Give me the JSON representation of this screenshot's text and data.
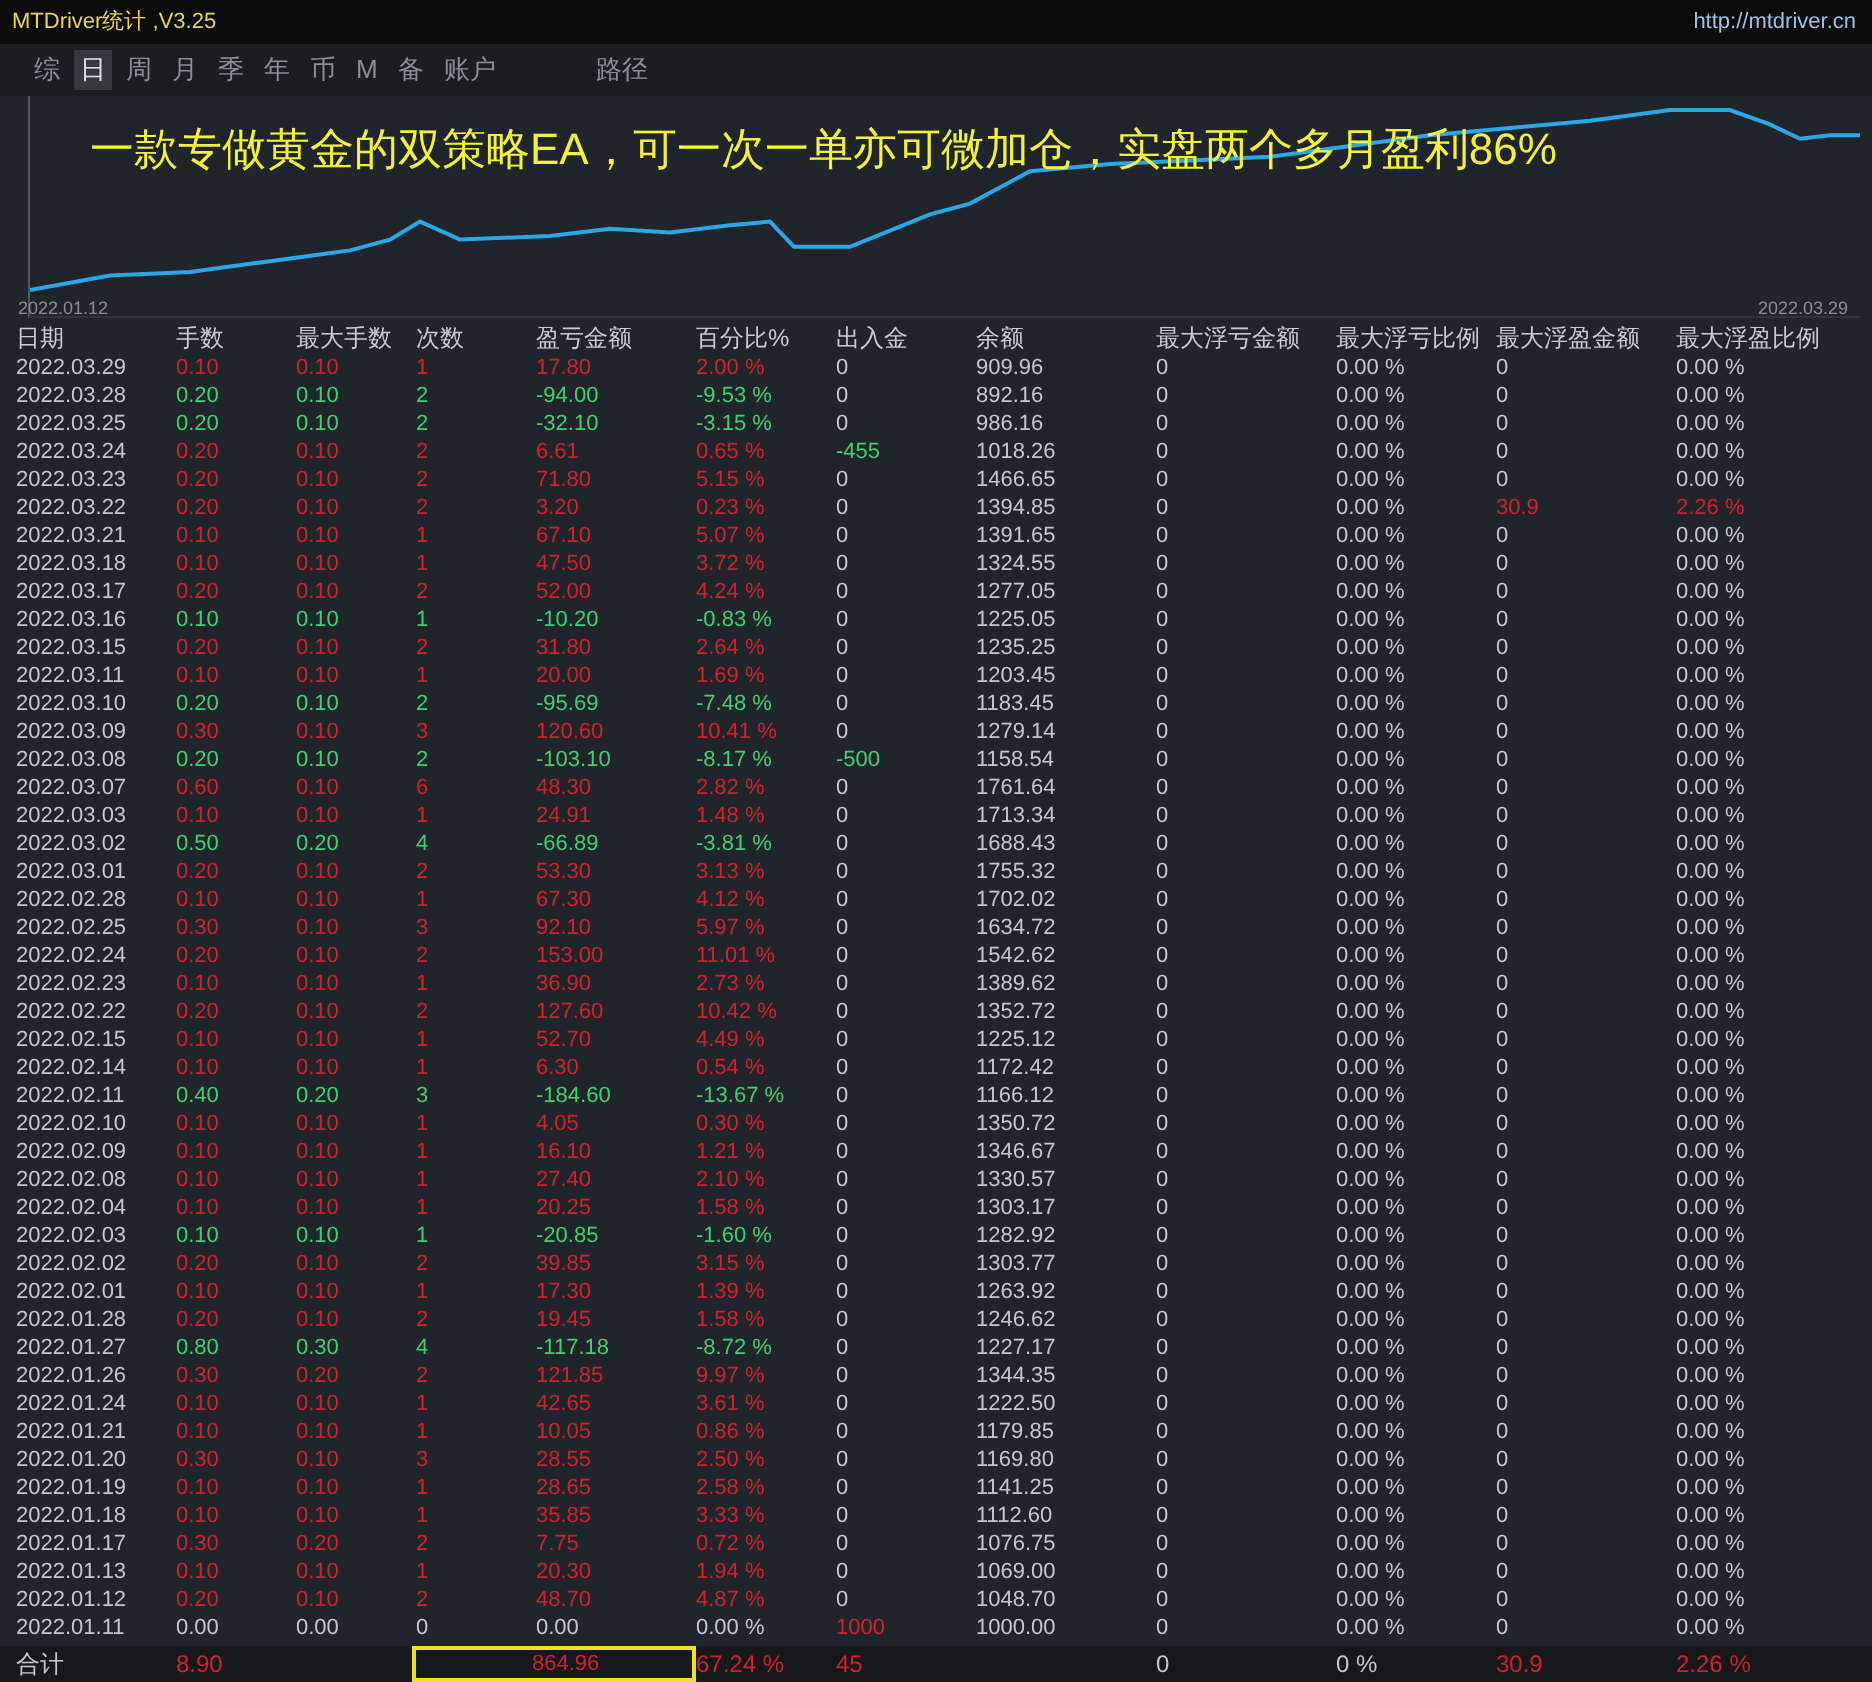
{
  "window": {
    "title": "MTDriver统计 ,V3.25",
    "link": "http://mtdriver.cn"
  },
  "tabs": [
    {
      "label": "综",
      "selected": false
    },
    {
      "label": "日",
      "selected": true
    },
    {
      "label": "周",
      "selected": false
    },
    {
      "label": "月",
      "selected": false
    },
    {
      "label": "季",
      "selected": false
    },
    {
      "label": "年",
      "selected": false
    },
    {
      "label": "币",
      "selected": false
    },
    {
      "label": "M",
      "selected": false
    },
    {
      "label": "备",
      "selected": false
    },
    {
      "label": "账户",
      "selected": false
    },
    {
      "label": "路径",
      "selected": false
    }
  ],
  "chart": {
    "caption": "一款专做黄金的双策略EA，可一次一单亦可微加仓，实盘两个多月盈利86%",
    "start_label": "2022.01.12",
    "end_label": "2022.03.29"
  },
  "table": {
    "columns": [
      "日期",
      "手数",
      "最大手数",
      "次数",
      "盈亏金额",
      "百分比%",
      "出入金",
      "余额",
      "最大浮亏金额",
      "最大浮亏比例",
      "最大浮盈金额",
      "最大浮盈比例"
    ],
    "rows": [
      {
        "kind": "profit",
        "withdrawal": false,
        "deposit": false,
        "float_profit": false,
        "cells": [
          "2022.03.29",
          "0.10",
          "0.10",
          "1",
          "17.80",
          "2.00 %",
          "0",
          "909.96",
          "0",
          "0.00 %",
          "0",
          "0.00 %"
        ]
      },
      {
        "kind": "loss",
        "withdrawal": false,
        "deposit": false,
        "float_profit": false,
        "cells": [
          "2022.03.28",
          "0.20",
          "0.10",
          "2",
          "-94.00",
          "-9.53 %",
          "0",
          "892.16",
          "0",
          "0.00 %",
          "0",
          "0.00 %"
        ]
      },
      {
        "kind": "loss",
        "withdrawal": false,
        "deposit": false,
        "float_profit": false,
        "cells": [
          "2022.03.25",
          "0.20",
          "0.10",
          "2",
          "-32.10",
          "-3.15 %",
          "0",
          "986.16",
          "0",
          "0.00 %",
          "0",
          "0.00 %"
        ]
      },
      {
        "kind": "profit",
        "withdrawal": true,
        "deposit": false,
        "float_profit": false,
        "cells": [
          "2022.03.24",
          "0.20",
          "0.10",
          "2",
          "6.61",
          "0.65 %",
          "-455",
          "1018.26",
          "0",
          "0.00 %",
          "0",
          "0.00 %"
        ]
      },
      {
        "kind": "profit",
        "withdrawal": false,
        "deposit": false,
        "float_profit": false,
        "cells": [
          "2022.03.23",
          "0.20",
          "0.10",
          "2",
          "71.80",
          "5.15 %",
          "0",
          "1466.65",
          "0",
          "0.00 %",
          "0",
          "0.00 %"
        ]
      },
      {
        "kind": "profit",
        "withdrawal": false,
        "deposit": false,
        "float_profit": true,
        "cells": [
          "2022.03.22",
          "0.20",
          "0.10",
          "2",
          "3.20",
          "0.23 %",
          "0",
          "1394.85",
          "0",
          "0.00 %",
          "30.9",
          "2.26 %"
        ]
      },
      {
        "kind": "profit",
        "withdrawal": false,
        "deposit": false,
        "float_profit": false,
        "cells": [
          "2022.03.21",
          "0.10",
          "0.10",
          "1",
          "67.10",
          "5.07 %",
          "0",
          "1391.65",
          "0",
          "0.00 %",
          "0",
          "0.00 %"
        ]
      },
      {
        "kind": "profit",
        "withdrawal": false,
        "deposit": false,
        "float_profit": false,
        "cells": [
          "2022.03.18",
          "0.10",
          "0.10",
          "1",
          "47.50",
          "3.72 %",
          "0",
          "1324.55",
          "0",
          "0.00 %",
          "0",
          "0.00 %"
        ]
      },
      {
        "kind": "profit",
        "withdrawal": false,
        "deposit": false,
        "float_profit": false,
        "cells": [
          "2022.03.17",
          "0.20",
          "0.10",
          "2",
          "52.00",
          "4.24 %",
          "0",
          "1277.05",
          "0",
          "0.00 %",
          "0",
          "0.00 %"
        ]
      },
      {
        "kind": "loss",
        "withdrawal": false,
        "deposit": false,
        "float_profit": false,
        "cells": [
          "2022.03.16",
          "0.10",
          "0.10",
          "1",
          "-10.20",
          "-0.83 %",
          "0",
          "1225.05",
          "0",
          "0.00 %",
          "0",
          "0.00 %"
        ]
      },
      {
        "kind": "profit",
        "withdrawal": false,
        "deposit": false,
        "float_profit": false,
        "cells": [
          "2022.03.15",
          "0.20",
          "0.10",
          "2",
          "31.80",
          "2.64 %",
          "0",
          "1235.25",
          "0",
          "0.00 %",
          "0",
          "0.00 %"
        ]
      },
      {
        "kind": "profit",
        "withdrawal": false,
        "deposit": false,
        "float_profit": false,
        "cells": [
          "2022.03.11",
          "0.10",
          "0.10",
          "1",
          "20.00",
          "1.69 %",
          "0",
          "1203.45",
          "0",
          "0.00 %",
          "0",
          "0.00 %"
        ]
      },
      {
        "kind": "loss",
        "withdrawal": false,
        "deposit": false,
        "float_profit": false,
        "cells": [
          "2022.03.10",
          "0.20",
          "0.10",
          "2",
          "-95.69",
          "-7.48 %",
          "0",
          "1183.45",
          "0",
          "0.00 %",
          "0",
          "0.00 %"
        ]
      },
      {
        "kind": "profit",
        "withdrawal": false,
        "deposit": false,
        "float_profit": false,
        "cells": [
          "2022.03.09",
          "0.30",
          "0.10",
          "3",
          "120.60",
          "10.41 %",
          "0",
          "1279.14",
          "0",
          "0.00 %",
          "0",
          "0.00 %"
        ]
      },
      {
        "kind": "loss",
        "withdrawal": true,
        "deposit": false,
        "float_profit": false,
        "cells": [
          "2022.03.08",
          "0.20",
          "0.10",
          "2",
          "-103.10",
          "-8.17 %",
          "-500",
          "1158.54",
          "0",
          "0.00 %",
          "0",
          "0.00 %"
        ]
      },
      {
        "kind": "profit",
        "withdrawal": false,
        "deposit": false,
        "float_profit": false,
        "cells": [
          "2022.03.07",
          "0.60",
          "0.10",
          "6",
          "48.30",
          "2.82 %",
          "0",
          "1761.64",
          "0",
          "0.00 %",
          "0",
          "0.00 %"
        ]
      },
      {
        "kind": "profit",
        "withdrawal": false,
        "deposit": false,
        "float_profit": false,
        "cells": [
          "2022.03.03",
          "0.10",
          "0.10",
          "1",
          "24.91",
          "1.48 %",
          "0",
          "1713.34",
          "0",
          "0.00 %",
          "0",
          "0.00 %"
        ]
      },
      {
        "kind": "loss",
        "withdrawal": false,
        "deposit": false,
        "float_profit": false,
        "cells": [
          "2022.03.02",
          "0.50",
          "0.20",
          "4",
          "-66.89",
          "-3.81 %",
          "0",
          "1688.43",
          "0",
          "0.00 %",
          "0",
          "0.00 %"
        ]
      },
      {
        "kind": "profit",
        "withdrawal": false,
        "deposit": false,
        "float_profit": false,
        "cells": [
          "2022.03.01",
          "0.20",
          "0.10",
          "2",
          "53.30",
          "3.13 %",
          "0",
          "1755.32",
          "0",
          "0.00 %",
          "0",
          "0.00 %"
        ]
      },
      {
        "kind": "profit",
        "withdrawal": false,
        "deposit": false,
        "float_profit": false,
        "cells": [
          "2022.02.28",
          "0.10",
          "0.10",
          "1",
          "67.30",
          "4.12 %",
          "0",
          "1702.02",
          "0",
          "0.00 %",
          "0",
          "0.00 %"
        ]
      },
      {
        "kind": "profit",
        "withdrawal": false,
        "deposit": false,
        "float_profit": false,
        "cells": [
          "2022.02.25",
          "0.30",
          "0.10",
          "3",
          "92.10",
          "5.97 %",
          "0",
          "1634.72",
          "0",
          "0.00 %",
          "0",
          "0.00 %"
        ]
      },
      {
        "kind": "profit",
        "withdrawal": false,
        "deposit": false,
        "float_profit": false,
        "cells": [
          "2022.02.24",
          "0.20",
          "0.10",
          "2",
          "153.00",
          "11.01 %",
          "0",
          "1542.62",
          "0",
          "0.00 %",
          "0",
          "0.00 %"
        ]
      },
      {
        "kind": "profit",
        "withdrawal": false,
        "deposit": false,
        "float_profit": false,
        "cells": [
          "2022.02.23",
          "0.10",
          "0.10",
          "1",
          "36.90",
          "2.73 %",
          "0",
          "1389.62",
          "0",
          "0.00 %",
          "0",
          "0.00 %"
        ]
      },
      {
        "kind": "profit",
        "withdrawal": false,
        "deposit": false,
        "float_profit": false,
        "cells": [
          "2022.02.22",
          "0.20",
          "0.10",
          "2",
          "127.60",
          "10.42 %",
          "0",
          "1352.72",
          "0",
          "0.00 %",
          "0",
          "0.00 %"
        ]
      },
      {
        "kind": "profit",
        "withdrawal": false,
        "deposit": false,
        "float_profit": false,
        "cells": [
          "2022.02.15",
          "0.10",
          "0.10",
          "1",
          "52.70",
          "4.49 %",
          "0",
          "1225.12",
          "0",
          "0.00 %",
          "0",
          "0.00 %"
        ]
      },
      {
        "kind": "profit",
        "withdrawal": false,
        "deposit": false,
        "float_profit": false,
        "cells": [
          "2022.02.14",
          "0.10",
          "0.10",
          "1",
          "6.30",
          "0.54 %",
          "0",
          "1172.42",
          "0",
          "0.00 %",
          "0",
          "0.00 %"
        ]
      },
      {
        "kind": "loss",
        "withdrawal": false,
        "deposit": false,
        "float_profit": false,
        "cells": [
          "2022.02.11",
          "0.40",
          "0.20",
          "3",
          "-184.60",
          "-13.67 %",
          "0",
          "1166.12",
          "0",
          "0.00 %",
          "0",
          "0.00 %"
        ]
      },
      {
        "kind": "profit",
        "withdrawal": false,
        "deposit": false,
        "float_profit": false,
        "cells": [
          "2022.02.10",
          "0.10",
          "0.10",
          "1",
          "4.05",
          "0.30 %",
          "0",
          "1350.72",
          "0",
          "0.00 %",
          "0",
          "0.00 %"
        ]
      },
      {
        "kind": "profit",
        "withdrawal": false,
        "deposit": false,
        "float_profit": false,
        "cells": [
          "2022.02.09",
          "0.10",
          "0.10",
          "1",
          "16.10",
          "1.21 %",
          "0",
          "1346.67",
          "0",
          "0.00 %",
          "0",
          "0.00 %"
        ]
      },
      {
        "kind": "profit",
        "withdrawal": false,
        "deposit": false,
        "float_profit": false,
        "cells": [
          "2022.02.08",
          "0.10",
          "0.10",
          "1",
          "27.40",
          "2.10 %",
          "0",
          "1330.57",
          "0",
          "0.00 %",
          "0",
          "0.00 %"
        ]
      },
      {
        "kind": "profit",
        "withdrawal": false,
        "deposit": false,
        "float_profit": false,
        "cells": [
          "2022.02.04",
          "0.10",
          "0.10",
          "1",
          "20.25",
          "1.58 %",
          "0",
          "1303.17",
          "0",
          "0.00 %",
          "0",
          "0.00 %"
        ]
      },
      {
        "kind": "loss",
        "withdrawal": false,
        "deposit": false,
        "float_profit": false,
        "cells": [
          "2022.02.03",
          "0.10",
          "0.10",
          "1",
          "-20.85",
          "-1.60 %",
          "0",
          "1282.92",
          "0",
          "0.00 %",
          "0",
          "0.00 %"
        ]
      },
      {
        "kind": "profit",
        "withdrawal": false,
        "deposit": false,
        "float_profit": false,
        "cells": [
          "2022.02.02",
          "0.20",
          "0.10",
          "2",
          "39.85",
          "3.15 %",
          "0",
          "1303.77",
          "0",
          "0.00 %",
          "0",
          "0.00 %"
        ]
      },
      {
        "kind": "profit",
        "withdrawal": false,
        "deposit": false,
        "float_profit": false,
        "cells": [
          "2022.02.01",
          "0.10",
          "0.10",
          "1",
          "17.30",
          "1.39 %",
          "0",
          "1263.92",
          "0",
          "0.00 %",
          "0",
          "0.00 %"
        ]
      },
      {
        "kind": "profit",
        "withdrawal": false,
        "deposit": false,
        "float_profit": false,
        "cells": [
          "2022.01.28",
          "0.20",
          "0.10",
          "2",
          "19.45",
          "1.58 %",
          "0",
          "1246.62",
          "0",
          "0.00 %",
          "0",
          "0.00 %"
        ]
      },
      {
        "kind": "loss",
        "withdrawal": false,
        "deposit": false,
        "float_profit": false,
        "cells": [
          "2022.01.27",
          "0.80",
          "0.30",
          "4",
          "-117.18",
          "-8.72 %",
          "0",
          "1227.17",
          "0",
          "0.00 %",
          "0",
          "0.00 %"
        ]
      },
      {
        "kind": "profit",
        "withdrawal": false,
        "deposit": false,
        "float_profit": false,
        "cells": [
          "2022.01.26",
          "0.30",
          "0.20",
          "2",
          "121.85",
          "9.97 %",
          "0",
          "1344.35",
          "0",
          "0.00 %",
          "0",
          "0.00 %"
        ]
      },
      {
        "kind": "profit",
        "withdrawal": false,
        "deposit": false,
        "float_profit": false,
        "cells": [
          "2022.01.24",
          "0.10",
          "0.10",
          "1",
          "42.65",
          "3.61 %",
          "0",
          "1222.50",
          "0",
          "0.00 %",
          "0",
          "0.00 %"
        ]
      },
      {
        "kind": "profit",
        "withdrawal": false,
        "deposit": false,
        "float_profit": false,
        "cells": [
          "2022.01.21",
          "0.10",
          "0.10",
          "1",
          "10.05",
          "0.86 %",
          "0",
          "1179.85",
          "0",
          "0.00 %",
          "0",
          "0.00 %"
        ]
      },
      {
        "kind": "profit",
        "withdrawal": false,
        "deposit": false,
        "float_profit": false,
        "cells": [
          "2022.01.20",
          "0.30",
          "0.10",
          "3",
          "28.55",
          "2.50 %",
          "0",
          "1169.80",
          "0",
          "0.00 %",
          "0",
          "0.00 %"
        ]
      },
      {
        "kind": "profit",
        "withdrawal": false,
        "deposit": false,
        "float_profit": false,
        "cells": [
          "2022.01.19",
          "0.10",
          "0.10",
          "1",
          "28.65",
          "2.58 %",
          "0",
          "1141.25",
          "0",
          "0.00 %",
          "0",
          "0.00 %"
        ]
      },
      {
        "kind": "profit",
        "withdrawal": false,
        "deposit": false,
        "float_profit": false,
        "cells": [
          "2022.01.18",
          "0.10",
          "0.10",
          "1",
          "35.85",
          "3.33 %",
          "0",
          "1112.60",
          "0",
          "0.00 %",
          "0",
          "0.00 %"
        ]
      },
      {
        "kind": "profit",
        "withdrawal": false,
        "deposit": false,
        "float_profit": false,
        "cells": [
          "2022.01.17",
          "0.30",
          "0.20",
          "2",
          "7.75",
          "0.72 %",
          "0",
          "1076.75",
          "0",
          "0.00 %",
          "0",
          "0.00 %"
        ]
      },
      {
        "kind": "profit",
        "withdrawal": false,
        "deposit": false,
        "float_profit": false,
        "cells": [
          "2022.01.13",
          "0.10",
          "0.10",
          "1",
          "20.30",
          "1.94 %",
          "0",
          "1069.00",
          "0",
          "0.00 %",
          "0",
          "0.00 %"
        ]
      },
      {
        "kind": "profit",
        "withdrawal": false,
        "deposit": false,
        "float_profit": false,
        "cells": [
          "2022.01.12",
          "0.20",
          "0.10",
          "2",
          "48.70",
          "4.87 %",
          "0",
          "1048.70",
          "0",
          "0.00 %",
          "0",
          "0.00 %"
        ]
      },
      {
        "kind": "flat",
        "withdrawal": false,
        "deposit": true,
        "float_profit": false,
        "cells": [
          "2022.01.11",
          "0.00",
          "0.00",
          "0",
          "0.00",
          "0.00 %",
          "1000",
          "1000.00",
          "0",
          "0.00 %",
          "0",
          "0.00 %"
        ]
      }
    ],
    "totals": {
      "label": "合计",
      "lots": "8.90",
      "pnl": "864.96",
      "pct": "67.24 %",
      "flow": "45",
      "max_float_loss": "0",
      "max_float_loss_pct": "0 %",
      "max_float_profit": "30.9",
      "max_float_profit_pct": "2.26 %"
    }
  }
}
